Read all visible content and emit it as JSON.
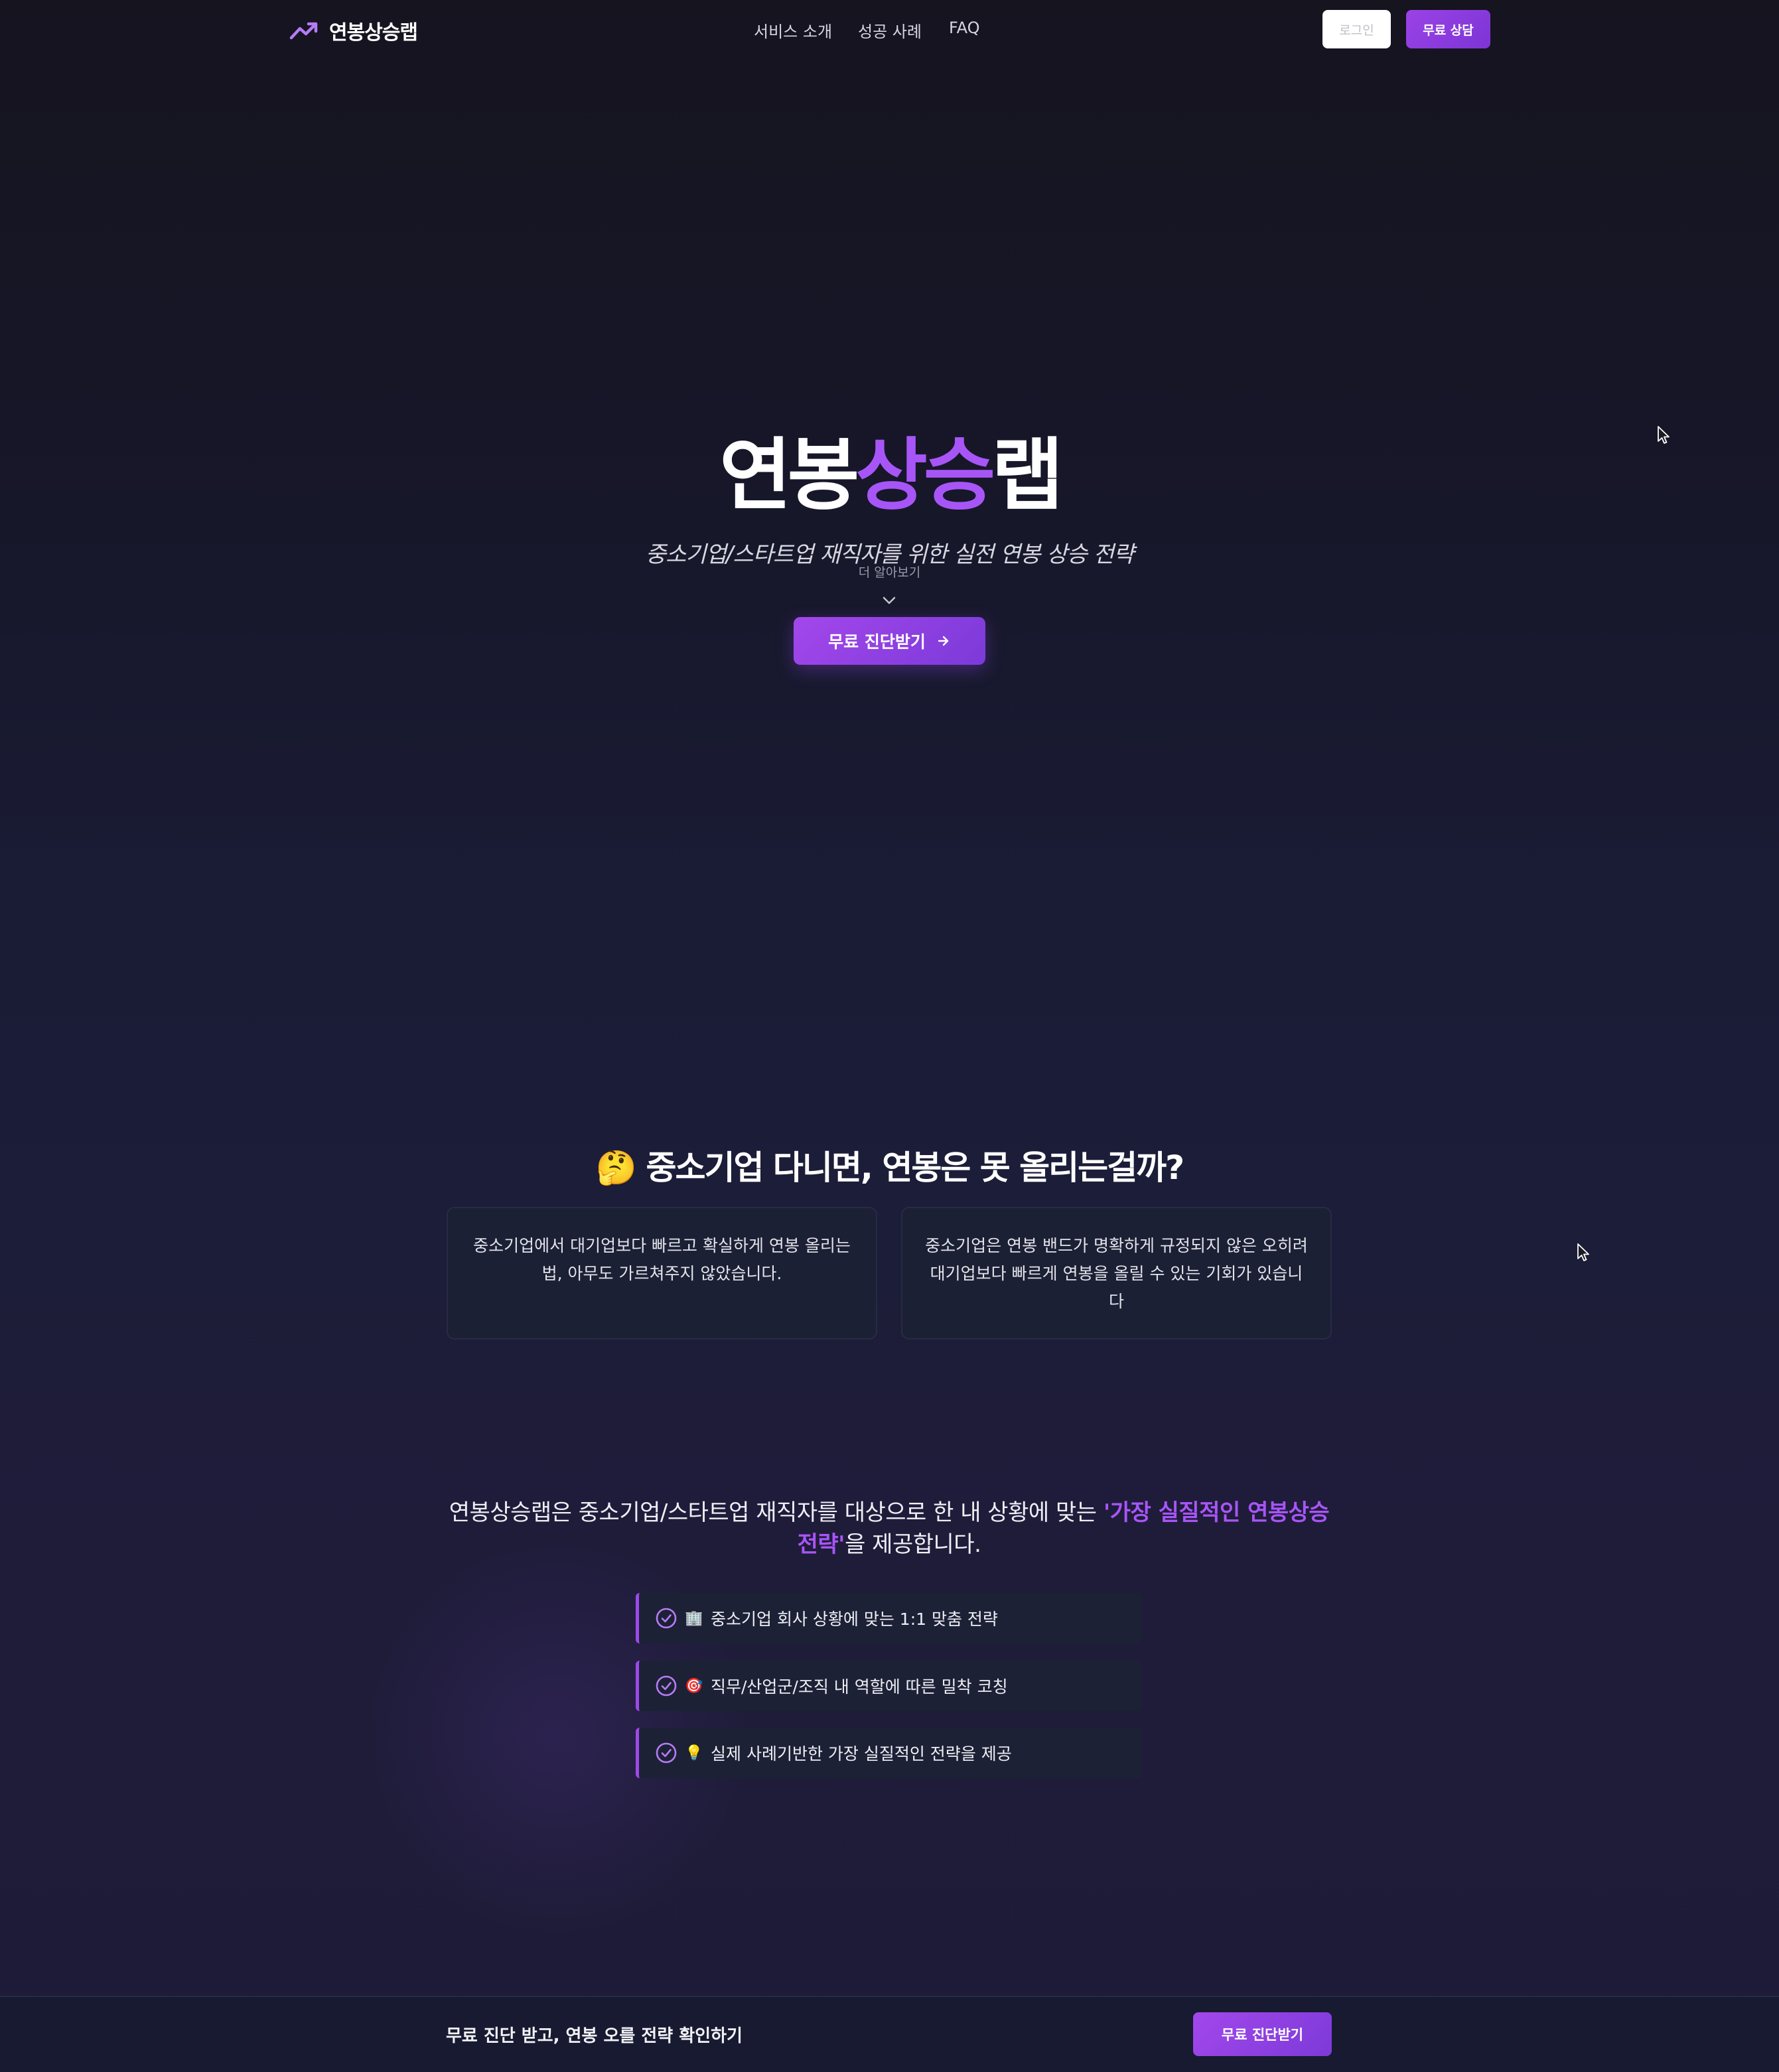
{
  "nav": {
    "logo_text": "연봉상승랩",
    "links": [
      "서비스 소개",
      "성공 사례",
      "FAQ"
    ],
    "login_label": "로그인",
    "consult_label": "무료 상담"
  },
  "hero": {
    "title_part1": "연봉",
    "title_accent": "상승",
    "title_part2": "랩",
    "subtitle": "중소기업/스타트업 재직자를 위한 실전 연봉 상승 전략",
    "more_label": "더 알아보기",
    "cta_label": "무료 진단받기"
  },
  "problem": {
    "emoji": "🤔",
    "title": "중소기업 다니면, 연봉은 못 올리는걸까?",
    "cards": [
      "중소기업에서 대기업보다 빠르고 확실하게 연봉 올리는 법, 아무도 가르쳐주지 않았습니다.",
      "중소기업은 연봉 밴드가 명확하게 규정되지 않은 오히려 대기업보다 빠르게 연봉을 올릴 수 있는 기회가 있습니다"
    ]
  },
  "intro": {
    "text_before": "연봉상승랩은 중소기업/스타트업 재직자를 대상으로 한 내 상황에 맞는 ",
    "highlight": "'가장 실질적인 연봉상승 전략'",
    "text_after": "을 제공합니다.",
    "features": [
      {
        "emoji": "🏢",
        "icon": "check-circle-icon",
        "text": "중소기업 회사 상황에 맞는 1:1 맞춤 전략"
      },
      {
        "emoji": "🎯",
        "icon": "check-circle-icon",
        "text": "직무/산업군/조직 내 역할에 따른 밀착 코칭"
      },
      {
        "emoji": "💡",
        "icon": "check-circle-icon",
        "text": "실제 사례기반한 가장 실질적인 전략을 제공"
      }
    ]
  },
  "bottom_bar": {
    "text": "무료 진단 받고, 연봉 오를 전략 확인하기",
    "cta_label": "무료 진단받기"
  },
  "colors": {
    "accent": "#a855f7",
    "background": "#1a1c36",
    "card": "#1c2035"
  }
}
